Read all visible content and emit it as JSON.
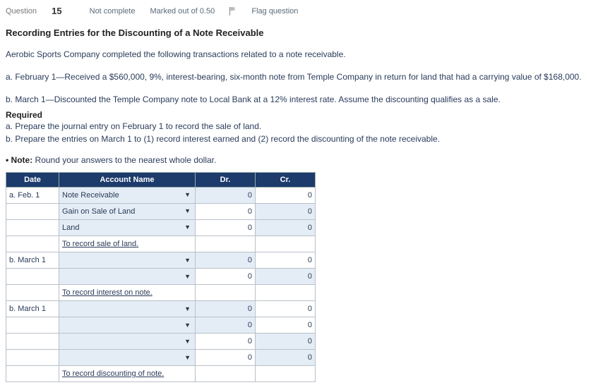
{
  "header": {
    "question_label": "Question",
    "question_number": "15",
    "status": "Not complete",
    "marked": "Marked out of 0.50",
    "flag": "Flag question"
  },
  "title": "Recording Entries for the Discounting of a Note Receivable",
  "intro": "Aerobic Sports Company completed the following transactions related to a note receivable.",
  "trans_a": "a. February 1—Received a $560,000, 9%, interest-bearing, six-month note from Temple Company in return for land that had a carrying value of $168,000.",
  "trans_b": "b. March 1—Discounted the Temple Company note to Local Bank at a 12% interest rate. Assume the discounting qualifies as a sale.",
  "required_label": "Required",
  "req_a": "a. Prepare the journal entry on February 1 to record the sale of land.",
  "req_b": "b. Prepare the entries on March 1 to (1) record interest earned and (2) record the discounting of the note receivable.",
  "note_prefix": "• Note:",
  "note_text": " Round your answers to the nearest whole dollar.",
  "table": {
    "h_date": "Date",
    "h_acct": "Account Name",
    "h_dr": "Dr.",
    "h_cr": "Cr."
  },
  "rows": {
    "r1": {
      "date": "a. Feb. 1",
      "acct": "Note Receivable",
      "dr": "0",
      "cr": "0"
    },
    "r2": {
      "acct": "Gain on Sale of Land",
      "dr": "0",
      "cr": "0"
    },
    "r3": {
      "acct": "Land",
      "dr": "0",
      "cr": "0"
    },
    "r4": {
      "memo": "To record sale of land."
    },
    "r5": {
      "date": "b. March 1",
      "dr": "0",
      "cr": "0"
    },
    "r6": {
      "dr": "0",
      "cr": "0"
    },
    "r7": {
      "memo": "To record interest on note."
    },
    "r8": {
      "date": "b. March 1",
      "dr": "0",
      "cr": "0"
    },
    "r9": {
      "dr": "0",
      "cr": "0"
    },
    "r10": {
      "dr": "0",
      "cr": "0"
    },
    "r11": {
      "dr": "0",
      "cr": "0"
    },
    "r12": {
      "memo": "To record discounting of note."
    }
  }
}
